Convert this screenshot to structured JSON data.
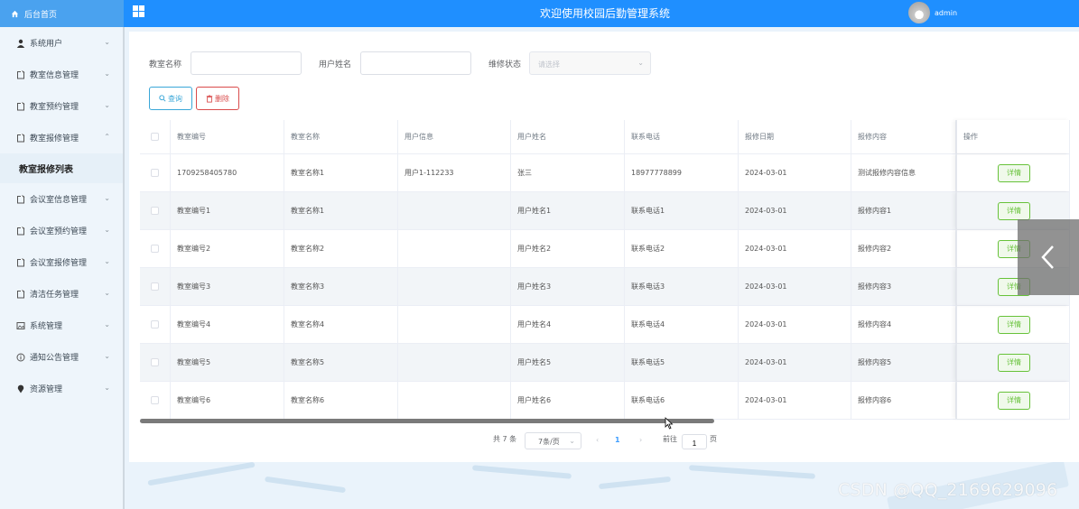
{
  "header": {
    "home_label": "后台首页",
    "title": "欢迎使用校园后勤管理系统",
    "user_name": "admin"
  },
  "sidebar": {
    "items": [
      {
        "label": "系统用户",
        "icon": "user-icon",
        "chevron": "⌄"
      },
      {
        "label": "教室信息管理",
        "icon": "document-icon",
        "chevron": "⌄"
      },
      {
        "label": "教室预约管理",
        "icon": "document-icon",
        "chevron": "⌄"
      },
      {
        "label": "教室报修管理",
        "icon": "document-icon",
        "chevron": "⌃"
      },
      {
        "label": "会议室信息管理",
        "icon": "document-icon",
        "chevron": "⌄"
      },
      {
        "label": "会议室预约管理",
        "icon": "document-icon",
        "chevron": "⌄"
      },
      {
        "label": "会议室报修管理",
        "icon": "document-icon",
        "chevron": "⌄"
      },
      {
        "label": "清洁任务管理",
        "icon": "document-icon",
        "chevron": "⌄"
      },
      {
        "label": "系统管理",
        "icon": "picture-icon",
        "chevron": "⌄"
      },
      {
        "label": "通知公告管理",
        "icon": "info-circle-icon",
        "chevron": "⌄"
      },
      {
        "label": "资源管理",
        "icon": "location-pin-icon",
        "chevron": "⌄"
      }
    ],
    "active_sub": "教室报修列表"
  },
  "search": {
    "classroom_name_label": "教室名称",
    "classroom_name_value": "",
    "user_name_label": "用户姓名",
    "user_name_value": "",
    "repair_status_label": "维修状态",
    "repair_status_placeholder": "请选择",
    "query_button": "查询",
    "delete_button": "删除"
  },
  "table": {
    "columns": [
      "教室编号",
      "教室名称",
      "用户信息",
      "用户姓名",
      "联系电话",
      "报修日期",
      "报修内容",
      "操作"
    ],
    "rows": [
      [
        "1709258405780",
        "教室名称1",
        "用户1-112233",
        "张三",
        "18977778899",
        "2024-03-01",
        "测试报修内容信息"
      ],
      [
        "教室编号1",
        "教室名称1",
        "",
        "用户姓名1",
        "联系电话1",
        "2024-03-01",
        "报修内容1"
      ],
      [
        "教室编号2",
        "教室名称2",
        "",
        "用户姓名2",
        "联系电话2",
        "2024-03-01",
        "报修内容2"
      ],
      [
        "教室编号3",
        "教室名称3",
        "",
        "用户姓名3",
        "联系电话3",
        "2024-03-01",
        "报修内容3"
      ],
      [
        "教室编号4",
        "教室名称4",
        "",
        "用户姓名4",
        "联系电话4",
        "2024-03-01",
        "报修内容4"
      ],
      [
        "教室编号5",
        "教室名称5",
        "",
        "用户姓名5",
        "联系电话5",
        "2024-03-01",
        "报修内容5"
      ],
      [
        "教室编号6",
        "教室名称6",
        "",
        "用户姓名6",
        "联系电话6",
        "2024-03-01",
        "报修内容6"
      ]
    ],
    "detail_label": "详情"
  },
  "pagination": {
    "total_text": "共 7 条",
    "page_size": "7条/页",
    "current_page": "1",
    "prev": "‹",
    "next": "›",
    "goto_label": "前往",
    "goto_value": "1",
    "page_suffix": "页"
  },
  "watermark": "CSDN @QQ_2169629096",
  "colors": {
    "primary": "#1f8fff",
    "success": "#67c23a",
    "danger": "#d94b4b"
  }
}
